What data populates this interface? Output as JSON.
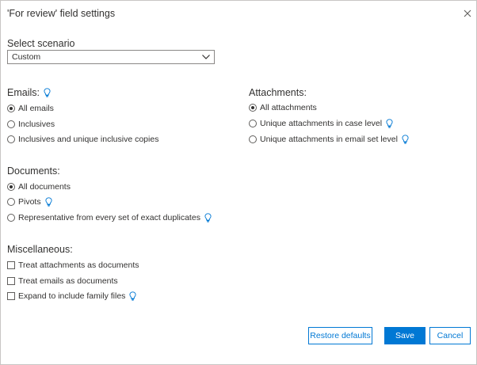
{
  "dialog": {
    "title": "'For review' field settings"
  },
  "scenario": {
    "label": "Select scenario",
    "selected": "Custom"
  },
  "emails": {
    "label": "Emails:",
    "options": [
      "All emails",
      "Inclusives",
      "Inclusives and unique inclusive copies"
    ],
    "selected_index": 0
  },
  "attachments": {
    "label": "Attachments:",
    "options": [
      "All attachments",
      "Unique attachments in case level",
      "Unique attachments in email set level"
    ],
    "selected_index": 0
  },
  "documents": {
    "label": "Documents:",
    "options": [
      "All documents",
      "Pivots",
      "Representative from every set of exact duplicates"
    ],
    "selected_index": 0
  },
  "miscellaneous": {
    "label": "Miscellaneous:",
    "options": [
      "Treat attachments as documents",
      "Treat emails as documents",
      "Expand to include family files"
    ],
    "checked": [
      false,
      false,
      false
    ]
  },
  "buttons": {
    "restore": "Restore defaults",
    "save": "Save",
    "cancel": "Cancel"
  },
  "colors": {
    "accent": "#0078d4",
    "border": "#c8c6c4",
    "text": "#323130"
  },
  "icons": {
    "close": "close-icon",
    "chevron": "chevron-down-icon",
    "info": "lightbulb-icon"
  }
}
